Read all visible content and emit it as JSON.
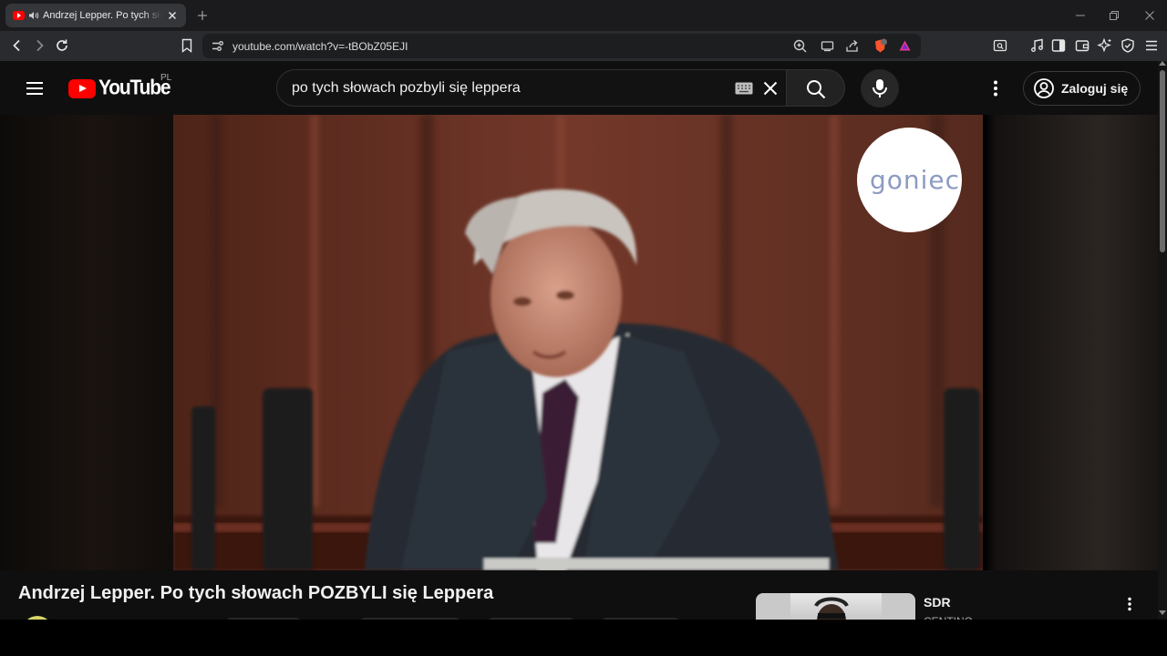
{
  "browser": {
    "tab": {
      "title": "Andrzej Lepper. Po tych słowach POZBYLI się Leppera"
    },
    "url": "youtube.com/watch?v=-tBObZ05EJI"
  },
  "youtube": {
    "logo_text": "YouTube",
    "country_code": "PL",
    "search": {
      "query": "po tych słowach pozbyli się leppera"
    },
    "signin_label": "Zaloguj się"
  },
  "video": {
    "title": "Andrzej Lepper. Po tych słowach POZBYLI się Leppera",
    "watermark_text": "goniec"
  },
  "recommendation": {
    "title": "SDR",
    "channel": "CENTINO"
  },
  "colors": {
    "brand_red": "#ff0000",
    "background": "#0f0f0f"
  },
  "icons": [
    "back-icon",
    "forward-icon",
    "reload-icon",
    "bookmark-icon",
    "site-info-icon",
    "zoom-icon",
    "cast-icon",
    "share-icon",
    "brave-shield-icon",
    "rewards-icon",
    "reader-mode-icon",
    "media-icon",
    "sidebar-icon",
    "wallet-icon",
    "leo-ai-icon",
    "vpn-icon",
    "menu-icon",
    "hamburger-icon",
    "keyboard-icon",
    "clear-icon",
    "search-icon",
    "mic-icon",
    "more-vert-icon",
    "account-icon"
  ]
}
